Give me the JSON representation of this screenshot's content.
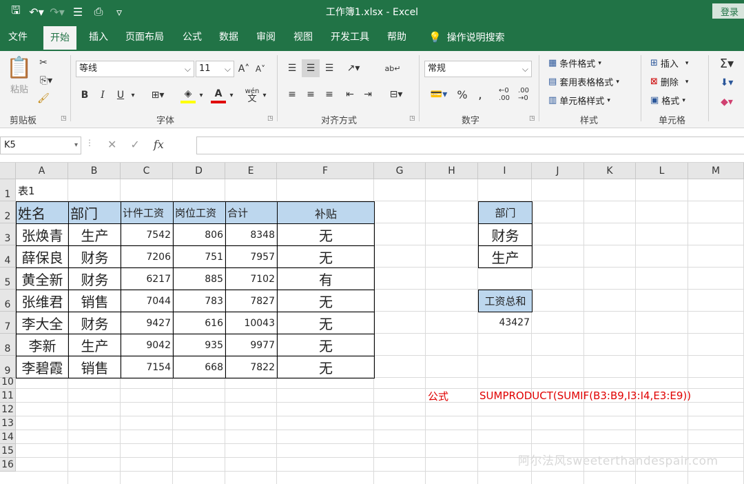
{
  "window": {
    "title": "工作簿1.xlsx  -  Excel",
    "sign_in": "登录"
  },
  "tabs": [
    "文件",
    "开始",
    "插入",
    "页面布局",
    "公式",
    "数据",
    "审阅",
    "视图",
    "开发工具",
    "帮助"
  ],
  "active_tab": "开始",
  "tell_me": "操作说明搜索",
  "ribbon": {
    "clipboard": {
      "paste": "粘贴",
      "label": "剪贴板"
    },
    "font": {
      "name": "等线",
      "size": "11",
      "label": "字体",
      "bold": "B",
      "italic": "I",
      "underline": "U",
      "phonetic": "wén"
    },
    "alignment": {
      "label": "对齐方式"
    },
    "number": {
      "format": "常规",
      "label": "数字",
      "percent": "%",
      "comma": ","
    },
    "styles": {
      "conditional": "条件格式",
      "table": "套用表格格式",
      "cell_styles": "单元格样式",
      "label": "样式"
    },
    "cells": {
      "insert": "插入",
      "delete": "删除",
      "format": "格式",
      "label": "单元格"
    }
  },
  "formula_bar": {
    "name_box": "K5",
    "fx": "fx",
    "value": ""
  },
  "columns": [
    "A",
    "B",
    "C",
    "D",
    "E",
    "F",
    "G",
    "H",
    "I",
    "J",
    "K",
    "L",
    "M"
  ],
  "rows": [
    "1",
    "2",
    "3",
    "4",
    "5",
    "6",
    "7",
    "8",
    "9",
    "10",
    "11",
    "12",
    "13",
    "14",
    "15",
    "16"
  ],
  "sheet": {
    "table_title": "表1",
    "headers": [
      "姓名",
      "部门",
      "计件工资",
      "岗位工资",
      "合计",
      "补贴"
    ],
    "records": [
      [
        "张焕青",
        "生产",
        "7542",
        "806",
        "8348",
        "无"
      ],
      [
        "薛保良",
        "财务",
        "7206",
        "751",
        "7957",
        "无"
      ],
      [
        "黄全新",
        "财务",
        "6217",
        "885",
        "7102",
        "有"
      ],
      [
        "张维君",
        "销售",
        "7044",
        "783",
        "7827",
        "无"
      ],
      [
        "李大全",
        "财务",
        "9427",
        "616",
        "10043",
        "无"
      ],
      [
        "李新",
        "生产",
        "9042",
        "935",
        "9977",
        "无"
      ],
      [
        "李碧霞",
        "销售",
        "7154",
        "668",
        "7822",
        "无"
      ]
    ],
    "criteria_header": "部门",
    "criteria": [
      "财务",
      "生产"
    ],
    "total_header": "工资总和",
    "total_value": "43427",
    "formula_label": "公式",
    "formula_text": "SUMPRODUCT(SUMIF(B3:B9,I3:I4,E3:E9))",
    "watermark": "阿尔法风sweeterthandespair.com"
  }
}
